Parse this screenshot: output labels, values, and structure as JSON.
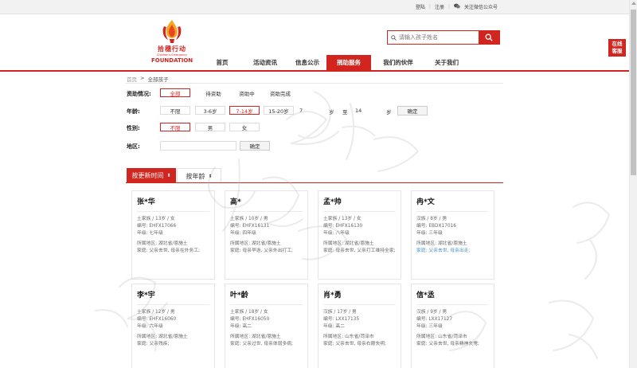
{
  "topbar": {
    "login": "登陆",
    "register": "注册",
    "wechat": "关注微信公众号"
  },
  "logo": {
    "cn": "拾穗行动",
    "sub": "Children's Emergency",
    "en": "FOUNDATION"
  },
  "search": {
    "placeholder": "请输入孩子姓名"
  },
  "nav": [
    {
      "label": "首页",
      "active": false
    },
    {
      "label": "活动资讯",
      "active": false
    },
    {
      "label": "信息公示",
      "active": false
    },
    {
      "label": "捐助服务",
      "active": true
    },
    {
      "label": "我们的伙伴",
      "active": false
    },
    {
      "label": "关于我们",
      "active": false
    }
  ],
  "float_service": {
    "line1": "在线",
    "line2": "客服"
  },
  "breadcrumb": {
    "home": "首页",
    "sep": ">",
    "current": "全部孩子"
  },
  "filters": {
    "status": {
      "label": "资助情况:",
      "options": [
        "全部",
        "待资助",
        "资助中",
        "资助完成"
      ]
    },
    "age": {
      "label": "年龄:",
      "options": [
        "不限",
        "3-6岁",
        "7-14岁",
        "15-20岁"
      ],
      "from": "7",
      "from_unit": "岁",
      "to_label": "至",
      "to": "14",
      "to_unit": "岁",
      "confirm": "确定"
    },
    "gender": {
      "label": "性别:",
      "options": [
        "不限",
        "男",
        "女"
      ]
    },
    "region": {
      "label": "地区:",
      "confirm": "确定"
    }
  },
  "sort": {
    "by_update": "按更新时间",
    "by_update_arrow": "⬍",
    "by_age": "按年龄",
    "by_age_arrow": "⬍"
  },
  "children": [
    {
      "name": "张*华",
      "meta": "土家族 / 13岁 / 女",
      "id": "编号: EHFX17066",
      "grade": "年级: 七年级",
      "region": "所属地区: 湖北省/恩施土",
      "family": "家庭: 父亲去世, 母亲在外务工;",
      "family_link": false
    },
    {
      "name": "高*",
      "meta": "土家族 / 10岁 / 男",
      "id": "编号: EHFX16131",
      "grade": "年级: 四年级",
      "region": "所属地区: 湖北省/恩施土",
      "family": "家庭: 母亲早逝, 父亲外出打工;",
      "family_link": false
    },
    {
      "name": "孟*帅",
      "meta": "土家族 / 13岁 / 女",
      "id": "编号: EHFX16130",
      "grade": "年级: 八年级",
      "region": "所属地区: 湖北省/恩施土",
      "family": "家庭: 母亲去世, 父亲打工维持全家;",
      "family_link": false
    },
    {
      "name": "冉*文",
      "meta": "汉族 / 8岁 / 男",
      "id": "编号: EBDX17016",
      "grade": "年级: 三年级",
      "region": "所属地区: 湖北省/恩施土",
      "family": "家庭: 父亲去世, 母亲出走;",
      "family_link": true
    },
    {
      "name": "李*宇",
      "meta": "土家族 / 12岁 / 男",
      "id": "编号: EHFX16060",
      "grade": "年级: 六年级",
      "region": "所属地区: 湖北省/恩施土",
      "family": "家庭: 父亲残疾;",
      "family_link": false
    },
    {
      "name": "叶*龄",
      "meta": "土家族 / 18岁 / 女",
      "id": "编号: EHFX16050",
      "grade": "年级: 高二",
      "region": "所属地区: 湖北省/恩施土",
      "family": "家庭: 父亲过世, 母亲体弱多病;",
      "family_link": false
    },
    {
      "name": "肖*勇",
      "meta": "汉族 / 17岁 / 男",
      "id": "编号: LXX17135",
      "grade": "年级: 高二",
      "region": "所属地区: 山东省/菏泽市",
      "family": "家庭: 父亲去世, 母亲右眼失明;",
      "family_link": false
    },
    {
      "name": "信*丞",
      "meta": "汉族 / 9岁 / 男",
      "id": "编号: LXX17127",
      "grade": "年级: 三年级",
      "region": "所属地区: 山东省/菏泽市",
      "family": "家庭: 父亲去世, 母亲精神失常;",
      "family_link": false
    }
  ]
}
